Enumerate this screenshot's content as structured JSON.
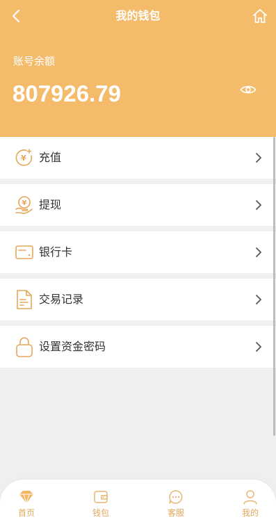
{
  "header": {
    "title": "我的钱包",
    "back_icon": "chevron-left-icon",
    "home_icon": "home-icon"
  },
  "balance": {
    "label": "账号余额",
    "value": "807926.79",
    "eye_icon": "eye-icon"
  },
  "menu": {
    "items": [
      {
        "label": "充值",
        "icon": "recharge-coin-icon"
      },
      {
        "label": "提现",
        "icon": "withdraw-hand-icon"
      },
      {
        "label": "银行卡",
        "icon": "bank-card-icon"
      },
      {
        "label": "交易记录",
        "icon": "document-icon"
      },
      {
        "label": "设置资金密码",
        "icon": "lock-icon"
      }
    ]
  },
  "tabbar": {
    "tabs": [
      {
        "label": "首页",
        "icon": "diamond-icon"
      },
      {
        "label": "钱包",
        "icon": "wallet-icon"
      },
      {
        "label": "客服",
        "icon": "chat-icon"
      },
      {
        "label": "我的",
        "icon": "user-icon"
      }
    ]
  },
  "colors": {
    "accent": "#f4bb6b",
    "icon": "#e6a75a",
    "background": "#efefef"
  }
}
